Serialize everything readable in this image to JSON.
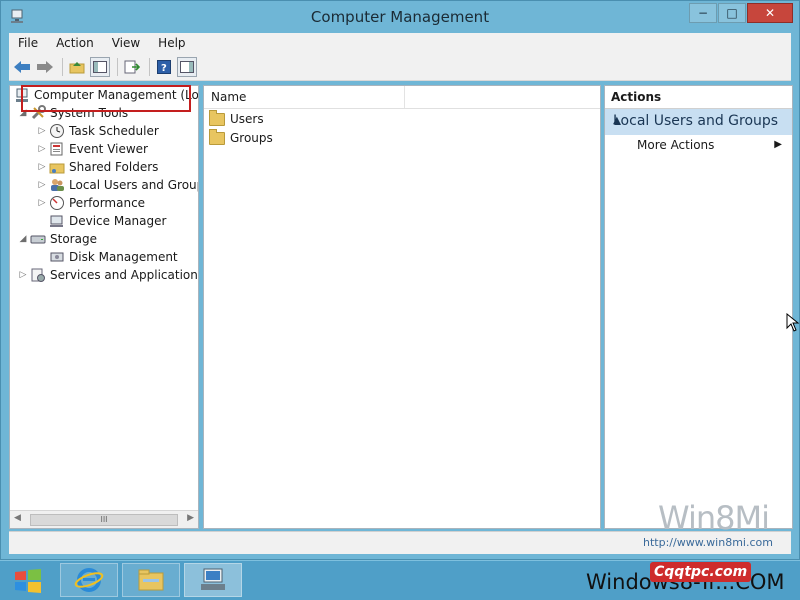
{
  "window": {
    "title": "Computer Management",
    "buttons": [
      "−",
      "□",
      "✕"
    ]
  },
  "menubar": [
    "File",
    "Action",
    "View",
    "Help"
  ],
  "tree": {
    "root": "Computer Management (Local",
    "items": [
      {
        "label": "System Tools",
        "expand": "◢"
      },
      {
        "label": "Task Scheduler",
        "expand": "▷"
      },
      {
        "label": "Event Viewer",
        "expand": "▷"
      },
      {
        "label": "Shared Folders",
        "expand": "▷"
      },
      {
        "label": "Local Users and Groups",
        "expand": "▷"
      },
      {
        "label": "Performance",
        "expand": "▷"
      },
      {
        "label": "Device Manager",
        "expand": ""
      },
      {
        "label": "Storage",
        "expand": "◢"
      },
      {
        "label": "Disk Management",
        "expand": ""
      },
      {
        "label": "Services and Applications",
        "expand": "▷"
      }
    ],
    "scroll_thumb": "III"
  },
  "list": {
    "column_name": "Name",
    "items": [
      "Users",
      "Groups"
    ]
  },
  "actions": {
    "header": "Actions",
    "selected": "Local Users and Groups",
    "more": "More Actions"
  },
  "watermark": {
    "brand": "Win8Mi",
    "url": "http://www.win8mi.com",
    "bottom_text": "Windows8-Tr...COM",
    "logo_text": "Cqqtpc.com"
  },
  "colors": {
    "window_frame": "#6fb6d6",
    "selection": "#c8dff2",
    "highlight_box": "#c41e1e",
    "taskbar": "#4f9fc8"
  }
}
